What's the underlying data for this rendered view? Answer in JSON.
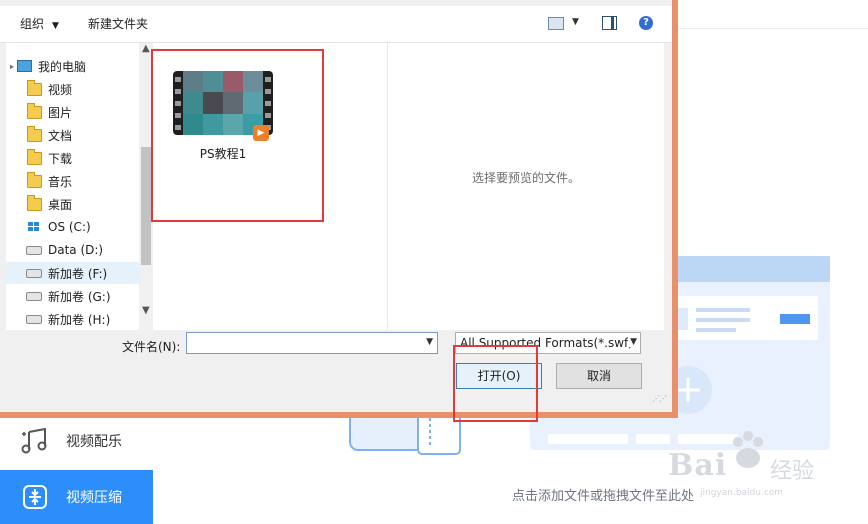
{
  "dialog": {
    "toolbar": {
      "organize": "组织",
      "new_folder": "新建文件夹"
    },
    "nav": {
      "items": [
        {
          "label": "我的电脑",
          "icon": "computer-icon"
        },
        {
          "label": "视频",
          "icon": "folder-icon"
        },
        {
          "label": "图片",
          "icon": "folder-icon"
        },
        {
          "label": "文档",
          "icon": "folder-icon"
        },
        {
          "label": "下载",
          "icon": "folder-icon"
        },
        {
          "label": "音乐",
          "icon": "folder-icon"
        },
        {
          "label": "桌面",
          "icon": "folder-icon"
        },
        {
          "label": "OS (C:)",
          "icon": "windows-drive-icon"
        },
        {
          "label": "Data (D:)",
          "icon": "drive-icon"
        },
        {
          "label": "新加卷 (F:)",
          "icon": "drive-icon",
          "selected": true
        },
        {
          "label": "新加卷 (G:)",
          "icon": "drive-icon"
        },
        {
          "label": "新加卷 (H:)",
          "icon": "drive-icon"
        }
      ]
    },
    "files": [
      {
        "name": "PS教程1",
        "type": "video"
      }
    ],
    "preview": {
      "empty_text": "选择要预览的文件。"
    },
    "bottom": {
      "filename_label": "文件名(N):",
      "filename_value": "",
      "format_selected": "All Supported Formats(*.swf;",
      "open_label": "打开(O)",
      "cancel_label": "取消"
    }
  },
  "app": {
    "sidebar": {
      "items": [
        {
          "label": "视频配乐",
          "icon": "music-icon"
        },
        {
          "label": "视频压缩",
          "icon": "compress-icon",
          "active": true
        }
      ]
    },
    "hint": "点击添加文件或拖拽文件至此处",
    "accent_color": "#2b8efb"
  },
  "watermark": {
    "brand": "Bai",
    "cn": "经验",
    "url": "jingyan.baidu.com"
  },
  "annotation_color": "#e23a3a"
}
